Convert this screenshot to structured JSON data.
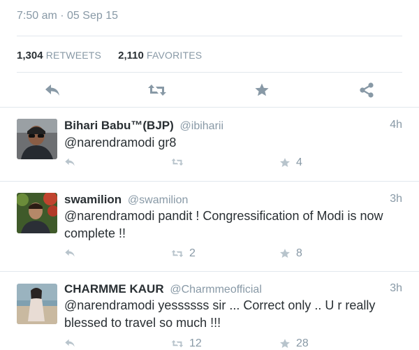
{
  "detail": {
    "top_text": "",
    "timestamp": "7:50 am · 05 Sep 15",
    "retweets": {
      "count": "1,304",
      "label": "RETWEETS"
    },
    "favorites": {
      "count": "2,110",
      "label": "FAVORITES"
    }
  },
  "action_icons": [
    "reply-icon",
    "retweet-icon",
    "favorite-icon",
    "share-icon"
  ],
  "replies": [
    {
      "name": "Bihari Babu™(BJP)",
      "handle": "@ibiharii",
      "time": "4h",
      "text": "@narendramodi gr8",
      "retweets": "",
      "favorites": "4"
    },
    {
      "name": "swamilion",
      "handle": "@swamilion",
      "time": "3h",
      "text": "@narendramodi pandit ! Congressification of Modi is now complete !!",
      "retweets": "2",
      "favorites": "8"
    },
    {
      "name": "CHARMME KAUR",
      "handle": "@Charmmeofficial",
      "time": "3h",
      "text": "@narendramodi yessssss sir ... Correct only .. U r really blessed to travel so much !!!",
      "retweets": "12",
      "favorites": "28"
    }
  ],
  "colors": {
    "text": "#292f33",
    "muted": "#8899a6",
    "icon": "#8899a6",
    "divider": "#e1e8ed"
  }
}
